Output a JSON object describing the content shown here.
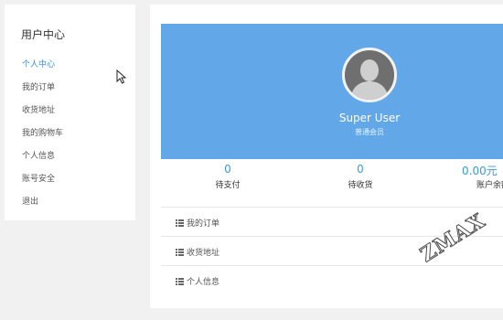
{
  "sidebar": {
    "title": "用户中心",
    "items": [
      {
        "label": "个人中心"
      },
      {
        "label": "我的订单"
      },
      {
        "label": "收货地址"
      },
      {
        "label": "我的购物车"
      },
      {
        "label": "个人信息"
      },
      {
        "label": "账号安全"
      },
      {
        "label": "退出"
      }
    ]
  },
  "profile": {
    "name": "Super User",
    "level": "普通会员"
  },
  "stats": [
    {
      "value": "0",
      "label": "待支付"
    },
    {
      "value": "0",
      "label": "待收货"
    },
    {
      "value": "0.00元",
      "label": "账户余额"
    }
  ],
  "links": [
    {
      "label": "我的订单",
      "icon": "list-icon"
    },
    {
      "label": "收货地址",
      "icon": "list-icon"
    },
    {
      "label": "个人信息",
      "icon": "list-icon"
    }
  ],
  "watermark": "ZMAX",
  "colors": {
    "accent": "#3b8fe0",
    "banner": "#62a8e8",
    "stat_value": "#3b9ad9",
    "background": "#f1f1f1"
  }
}
